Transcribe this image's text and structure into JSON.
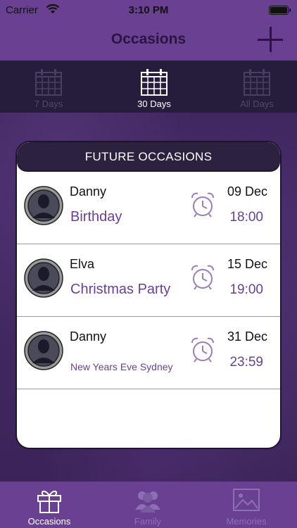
{
  "status_bar": {
    "carrier": "Carrier",
    "time": "3:10 PM"
  },
  "header": {
    "title": "Occasions",
    "add_icon": "plus-icon"
  },
  "range_tabs": [
    {
      "label": "7 Days",
      "icon": "calendar-icon",
      "selected": false
    },
    {
      "label": "30 Days",
      "icon": "calendar-icon",
      "selected": true
    },
    {
      "label": "All Days",
      "icon": "calendar-icon",
      "selected": false
    }
  ],
  "card": {
    "title": "FUTURE OCCASIONS",
    "items": [
      {
        "name": "Danny",
        "occasion": "Birthday",
        "date": "09 Dec",
        "time": "18:00"
      },
      {
        "name": "Elva",
        "occasion": "Christmas Party",
        "date": "15 Dec",
        "time": "19:00"
      },
      {
        "name": "Danny",
        "occasion": "New Years Eve Sydney",
        "date": "31 Dec",
        "time": "23:59"
      }
    ]
  },
  "tab_bar": [
    {
      "label": "Occasions",
      "icon": "gift-icon",
      "selected": true
    },
    {
      "label": "Family",
      "icon": "family-icon",
      "selected": false
    },
    {
      "label": "Memories",
      "icon": "picture-icon",
      "selected": false
    }
  ],
  "colors": {
    "accent": "#6a3f94",
    "nav_bg": "#6a4092",
    "tabs_bg": "#261c3c",
    "card_head": "#2c2240"
  }
}
